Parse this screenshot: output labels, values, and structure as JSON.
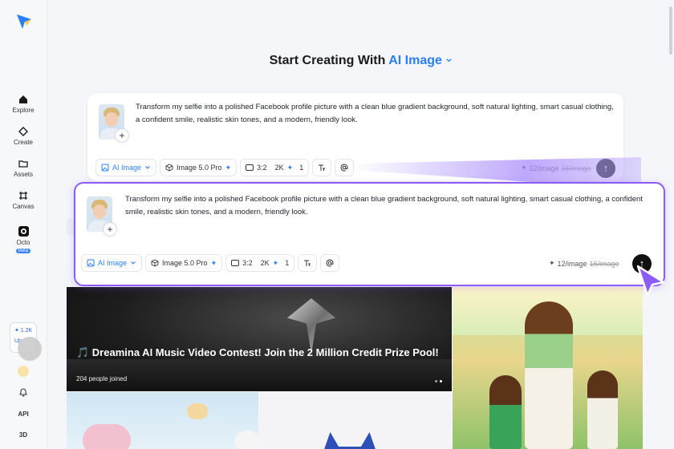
{
  "sidebar": {
    "items": [
      {
        "label": "Explore",
        "icon": "home-icon"
      },
      {
        "label": "Create",
        "icon": "diamond-icon"
      },
      {
        "label": "Assets",
        "icon": "folder-icon"
      },
      {
        "label": "Canvas",
        "icon": "canvas-icon"
      },
      {
        "label": "Octo",
        "icon": "octo-icon",
        "badge": "Beta"
      }
    ],
    "credits": {
      "amount": "✦ 1.2K",
      "upgrade": "Up"
    },
    "bottom": [
      "API",
      "3D"
    ]
  },
  "headline": {
    "prefix": "Start Creating With ",
    "accent": "AI Image"
  },
  "prompt": {
    "text": "Transform my selfie into a polished Facebook profile picture with a clean blue gradient background, soft natural lighting, smart casual clothing, a confident smile, realistic skin tones, and a modern, friendly look.",
    "add": "+",
    "mode": "AI Image",
    "model": "Image 5.0 Pro",
    "ratio": "3:2",
    "resolution": "2K",
    "count": "1",
    "price_label": "12/image",
    "price_old": "16/image",
    "send": "↑"
  },
  "gallery": {
    "hero_title": "🎵 Dreamina AI Music Video Contest! Join the 2 Million Credit Prize Pool!",
    "hero_joined": "204 people joined"
  },
  "colors": {
    "accent": "#2b7ff5",
    "highlight": "#8b5cf6"
  }
}
